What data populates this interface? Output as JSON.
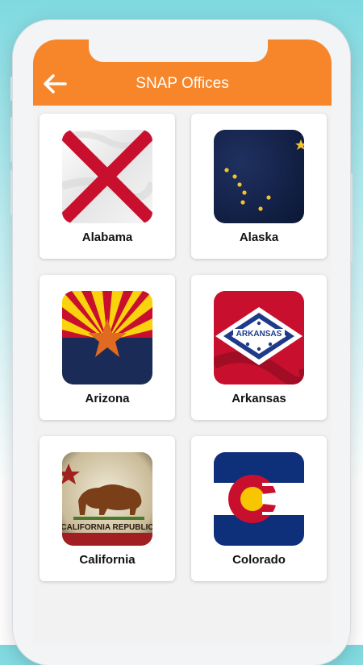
{
  "app": {
    "title": "SNAP Offices"
  },
  "icons": {
    "back": "arrow-left-icon"
  },
  "colors": {
    "appbar": "#f7862a",
    "card": "#ffffff"
  },
  "states": [
    {
      "name": "Alabama",
      "flag": "alabama-flag-icon"
    },
    {
      "name": "Alaska",
      "flag": "alaska-flag-icon"
    },
    {
      "name": "Arizona",
      "flag": "arizona-flag-icon"
    },
    {
      "name": "Arkansas",
      "flag": "arkansas-flag-icon"
    },
    {
      "name": "California",
      "flag": "california-flag-icon"
    },
    {
      "name": "Colorado",
      "flag": "colorado-flag-icon"
    }
  ]
}
